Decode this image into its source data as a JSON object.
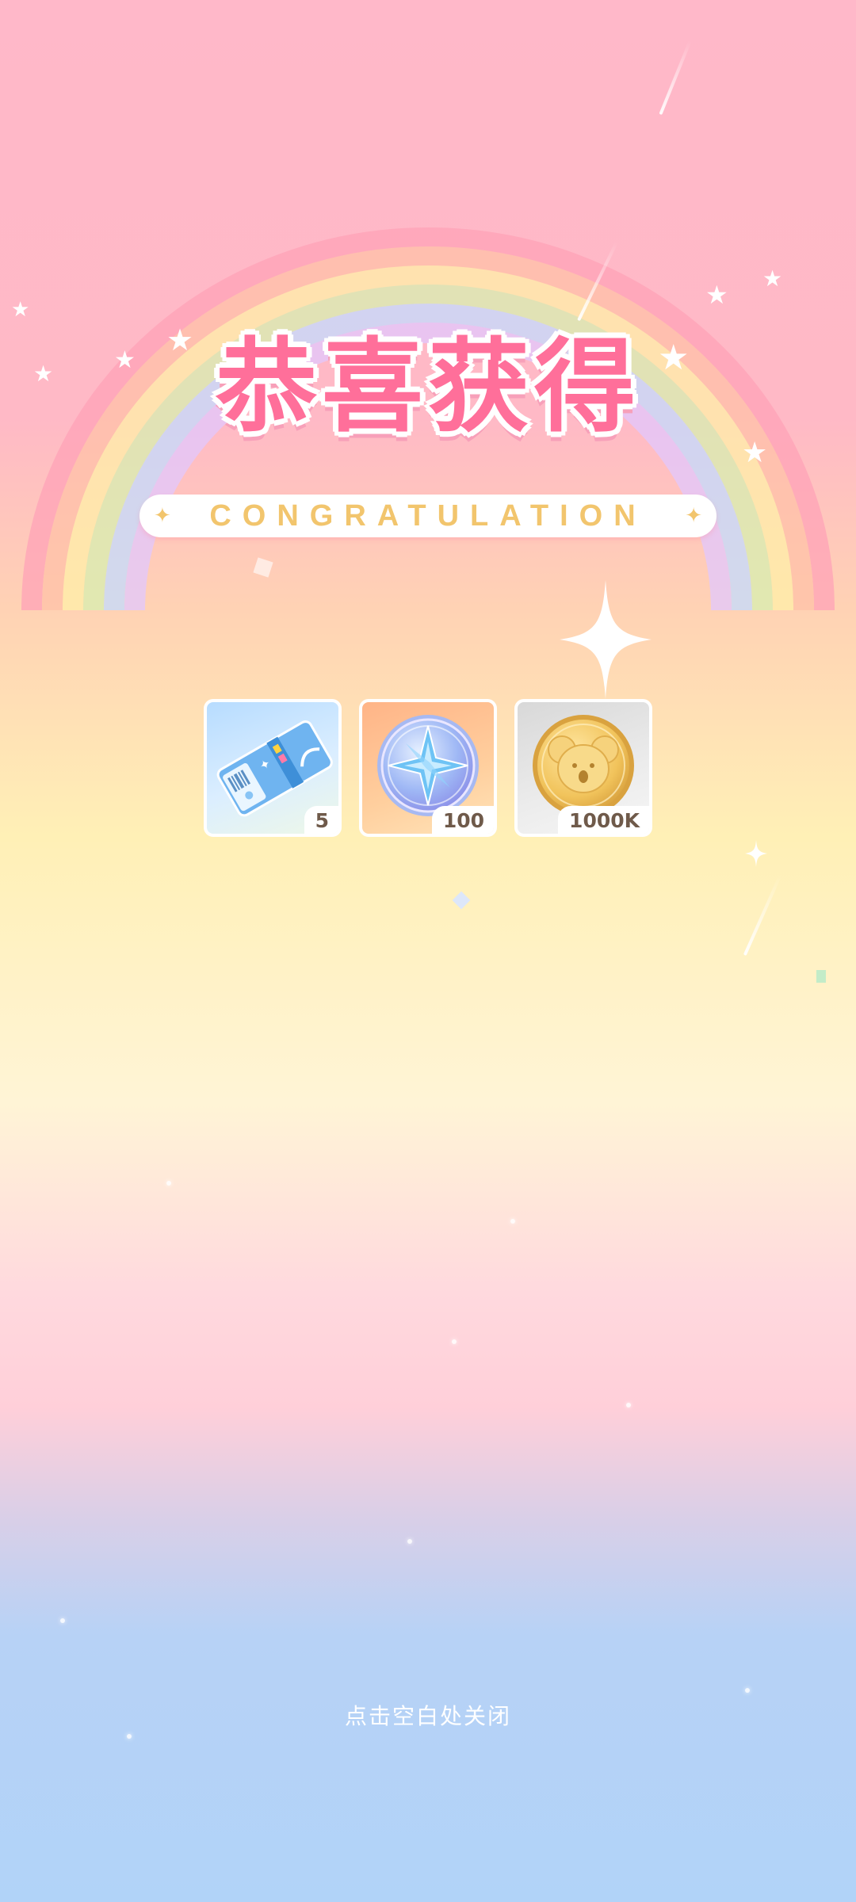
{
  "popup": {
    "title": "恭喜获得",
    "subtitle": "CONGRATULATION",
    "rewards": [
      {
        "icon": "ticket-icon",
        "quantity": "5"
      },
      {
        "icon": "star-compass-coin-icon",
        "quantity": "100"
      },
      {
        "icon": "koala-gold-coin-icon",
        "quantity": "1000K"
      }
    ],
    "close_hint": "点击空白处关闭"
  },
  "colors": {
    "title_pink": "#ff6f9a",
    "subtitle_gold": "#f2c56d",
    "quantity_text": "#6f5a4a"
  }
}
